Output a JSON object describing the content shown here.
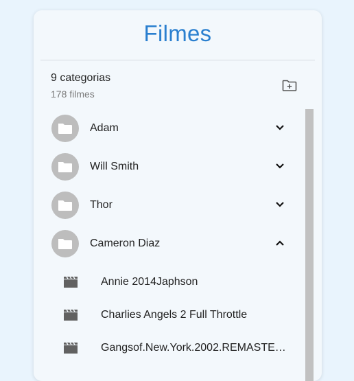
{
  "header": {
    "title": "Filmes"
  },
  "summary": {
    "categories": "9 categorias",
    "films": "178 filmes",
    "add_icon": "create-new-folder-icon"
  },
  "categories": [
    {
      "label": "Adam",
      "expanded": false
    },
    {
      "label": "Will Smith",
      "expanded": false
    },
    {
      "label": "Thor",
      "expanded": false
    },
    {
      "label": "Cameron Diaz",
      "expanded": true
    }
  ],
  "films": [
    {
      "label": "Annie 2014Japhson"
    },
    {
      "label": "Charlies Angels 2 Full Throttle"
    },
    {
      "label": "Gangsof.New.York.2002.REMASTERED"
    }
  ],
  "colors": {
    "accent": "#2a7fcf",
    "background": "#e9f4fd",
    "card": "#f3f8fc",
    "avatar": "#bdbdbd",
    "scrollbar": "#c1c1c1"
  }
}
